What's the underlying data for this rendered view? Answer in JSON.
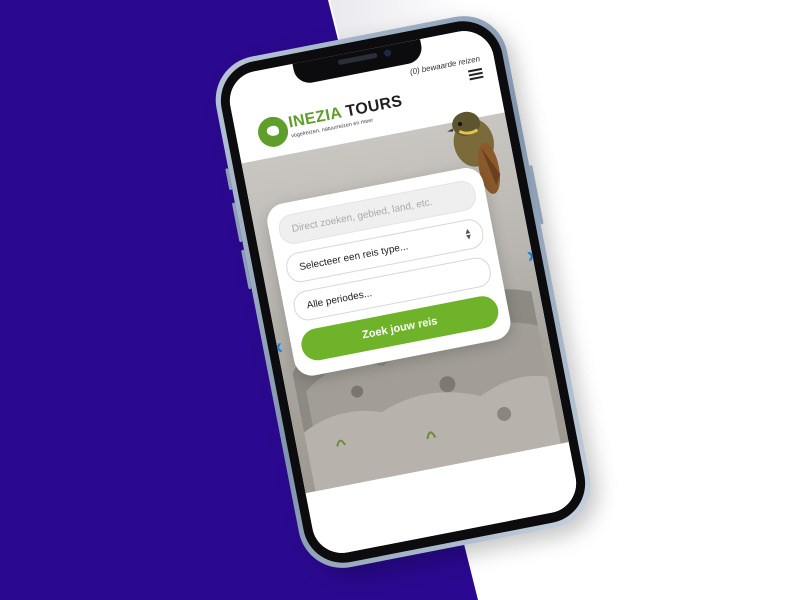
{
  "header": {
    "saved_trips": "(0) bewaarde reizen",
    "logo_name_part1": "INEZIA",
    "logo_name_part2": "TOURS",
    "logo_tagline": "vogelreizen, natuurreizen en meer",
    "menu_icon": "hamburger-icon"
  },
  "search": {
    "placeholder": "Direct zoeken, gebied, land, etc.",
    "type_select": "Selecteer een reis type...",
    "period_select": "Alle periodes...",
    "submit_label": "Zoek jouw reis"
  },
  "colors": {
    "brand_green": "#6fb32a",
    "background_purple": "#2a088f",
    "arrow_blue": "#1e7fd1"
  }
}
